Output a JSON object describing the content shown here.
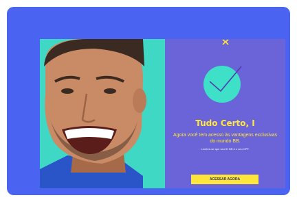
{
  "promo": {
    "headline": "Tudo Certo, I",
    "subtitle": "Agora você tem acesso às vantagens exclusivas do mundo BB.",
    "note": "Lembre-se que seu ID BB é o seu CPF.",
    "cta_label": "ACESSAR AGORA"
  },
  "icons": {
    "logo": "bb-logo",
    "status": "check-icon"
  },
  "colors": {
    "frame": "#4a63f0",
    "photo_background": "#3ed8c4",
    "panel": "#6b64d8",
    "accent_yellow": "#ffe63d",
    "check_circle": "#3fe0c8"
  }
}
